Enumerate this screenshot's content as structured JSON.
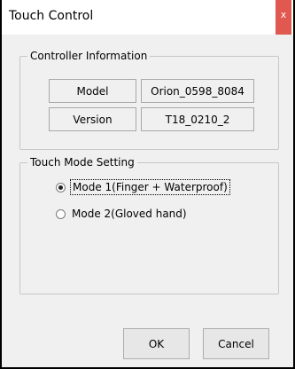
{
  "window": {
    "title": "Touch Control",
    "close_glyph": "x"
  },
  "controller_info": {
    "legend": "Controller Information",
    "rows": [
      {
        "label": "Model",
        "value": "Orion_0598_8084"
      },
      {
        "label": "Version",
        "value": "T18_0210_2"
      }
    ]
  },
  "touch_mode": {
    "legend": "Touch Mode Setting",
    "options": [
      {
        "label": "Mode 1(Finger + Waterproof)",
        "selected": true
      },
      {
        "label": "Mode 2(Gloved hand)",
        "selected": false
      }
    ]
  },
  "buttons": {
    "ok": "OK",
    "cancel": "Cancel"
  }
}
